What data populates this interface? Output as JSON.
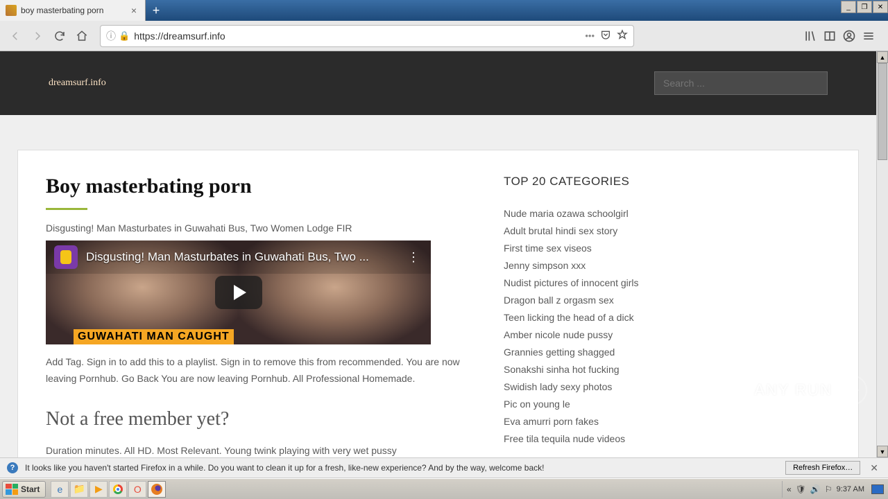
{
  "browser": {
    "tab_title": "boy masterbating porn",
    "url_display": "https://dreamsurf.info",
    "url_prefix": "https://"
  },
  "site": {
    "brand": "dreamsurf.info",
    "search_placeholder": "Search ..."
  },
  "article": {
    "title": "Boy masterbating porn",
    "byline": "Disgusting! Man Masturbates in Guwahati Bus, Two Women Lodge FIR",
    "video_title": "Disgusting! Man Masturbates in Guwahati Bus, Two ...",
    "chyron": "GUWAHATI MAN CAUGHT",
    "body1": "Add Tag. Sign in to add this to a playlist. Sign in to remove this from recommended. You are now leaving Pornhub. Go Back You are now leaving Pornhub. All Professional Homemade.",
    "h2": "Not a free member yet?",
    "body2": "Duration minutes. All HD. Most Relevant. Young twink playing with very wet pussy"
  },
  "sidebar": {
    "heading": "TOP 20 CATEGORIES",
    "items": [
      "Nude maria ozawa schoolgirl",
      "Adult brutal hindi sex story",
      "First time sex viseos",
      "Jenny simpson xxx",
      "Nudist pictures of innocent girls",
      "Dragon ball z orgasm sex",
      "Teen licking the head of a dick",
      "Amber nicole nude pussy",
      "Grannies getting shagged",
      "Sonakshi sinha hot fucking",
      "Swidish lady sexy photos",
      "Pic on young le",
      "Eva amurri porn fakes",
      "Free tila tequila nude videos"
    ]
  },
  "infobar": {
    "message": "It looks like you haven't started Firefox in a while. Do you want to clean it up for a fresh, like-new experience? And by the way, welcome back!",
    "button": "Refresh Firefox…"
  },
  "taskbar": {
    "start": "Start",
    "clock": "9:37 AM"
  },
  "watermark": "ANY RUN"
}
